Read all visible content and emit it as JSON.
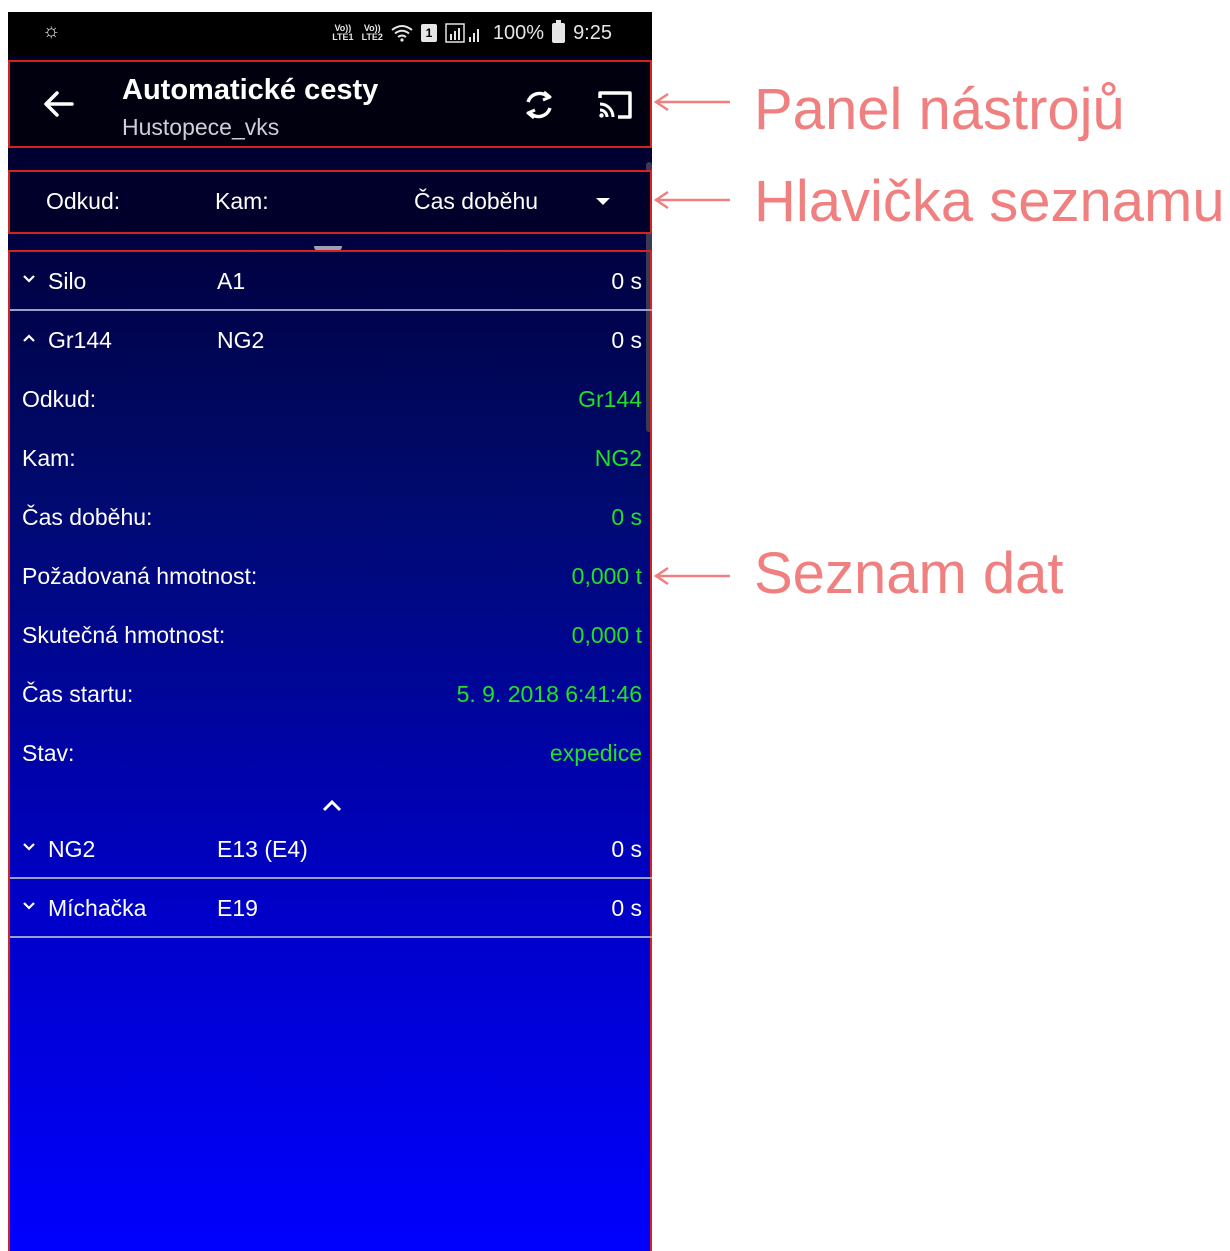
{
  "status_bar": {
    "left_icon": "brightness-icon",
    "volte1": "Vo)) LTE1",
    "volte2": "Vo)) LTE2",
    "battery": "100%",
    "time": "9:25"
  },
  "toolbar": {
    "title": "Automatické cesty",
    "subtitle": "Hustopece_vks",
    "icons": [
      "back-arrow-icon",
      "refresh-icon",
      "cast-icon"
    ]
  },
  "list_header": {
    "from_label": "Odkud:",
    "to_label": "Kam:",
    "sort_label": "Čas doběhu"
  },
  "rows": [
    {
      "from": "Silo",
      "to": "A1",
      "time": "0 s",
      "expanded": false
    },
    {
      "from": "Gr144",
      "to": "NG2",
      "time": "0 s",
      "expanded": true
    },
    {
      "from": "NG2",
      "to": "E13 (E4)",
      "time": "0 s",
      "expanded": false
    },
    {
      "from": "Míchačka",
      "to": "E19",
      "time": "0 s",
      "expanded": false
    }
  ],
  "details": [
    {
      "label": "Odkud:",
      "value": "Gr144"
    },
    {
      "label": "Kam:",
      "value": "NG2"
    },
    {
      "label": "Čas doběhu:",
      "value": "0 s"
    },
    {
      "label": "Požadovaná hmotnost:",
      "value": "0,000 t"
    },
    {
      "label": "Skutečná hmotnost:",
      "value": "0,000 t"
    },
    {
      "label": "Čas startu:",
      "value": "5. 9. 2018 6:41:46"
    },
    {
      "label": "Stav:",
      "value": "expedice"
    }
  ],
  "annotations": {
    "toolbar": "Panel nástrojů",
    "header": "Hlavička seznamu",
    "list": "Seznam dat"
  },
  "colors": {
    "highlight_border": "#d32222",
    "annotation_text": "#f08080",
    "detail_value": "#22e022"
  }
}
